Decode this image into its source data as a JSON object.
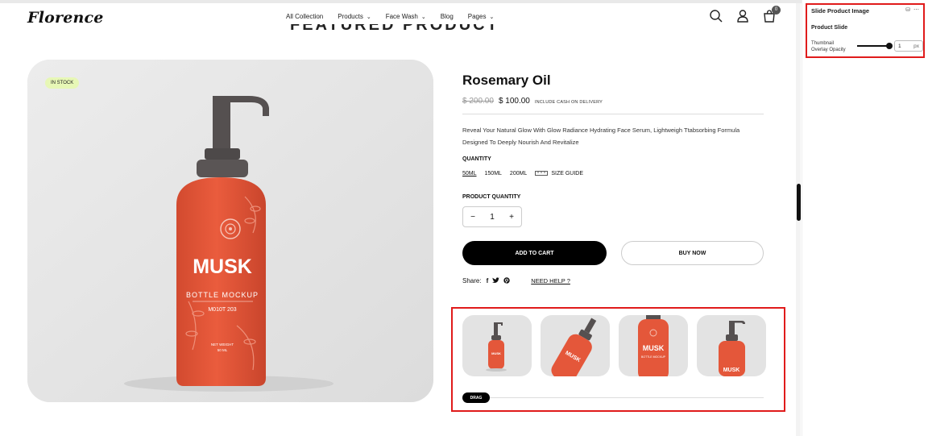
{
  "header": {
    "logo": "Florence",
    "nav": [
      {
        "label": "All Collection",
        "dropdown": false
      },
      {
        "label": "Products",
        "dropdown": true
      },
      {
        "label": "Face Wash",
        "dropdown": true
      },
      {
        "label": "Blog",
        "dropdown": false
      },
      {
        "label": "Pages",
        "dropdown": true
      }
    ],
    "cart_count": "0",
    "icons": [
      "search-icon",
      "user-icon",
      "cart-icon"
    ]
  },
  "section_title": "FEATURED PRODUCT",
  "product": {
    "badge": "IN STOCK",
    "bottle_text": {
      "brand": "MUSK",
      "line1": "BOTTLE MOCKUP",
      "line2": "M010T 203",
      "weight": "NET WEIGHT",
      "volume": "50 ML"
    },
    "title": "Rosemary Oil",
    "old_price": "$ 200.00",
    "new_price": "$ 100.00",
    "price_note": "INCLUDE CASH ON DELIVERY",
    "description": "Reveal Your Natural Glow With Glow Radiance Hydrating Face Serum, Lightweigh Ttabsorbing Formula Designed To Deeply Nourish And Revitalize",
    "quantity_label": "QUANTITY",
    "sizes": [
      "50ML",
      "150ML",
      "200ML"
    ],
    "selected_size": "50ML",
    "size_guide": "SIZE GUIDE",
    "product_quantity_label": "PRODUCT QUANTITY",
    "stepper": {
      "minus": "−",
      "value": "1",
      "plus": "+"
    },
    "add_to_cart": "ADD TO CART",
    "buy_now": "BUY NOW",
    "share_label": "Share:",
    "need_help": "NEED HELP ?",
    "drag_label": "DRAG"
  },
  "colors": {
    "bottle": "#e4573a",
    "cap": "#555050",
    "badge_bg": "#e7f7b6",
    "highlight": "#e01b1b"
  },
  "panel": {
    "title": "Slide Product Image",
    "subtitle": "Product Slide",
    "field_label_1": "Thumbnail",
    "field_label_2": "Overlay Opacity",
    "value": "1",
    "unit": "px"
  }
}
